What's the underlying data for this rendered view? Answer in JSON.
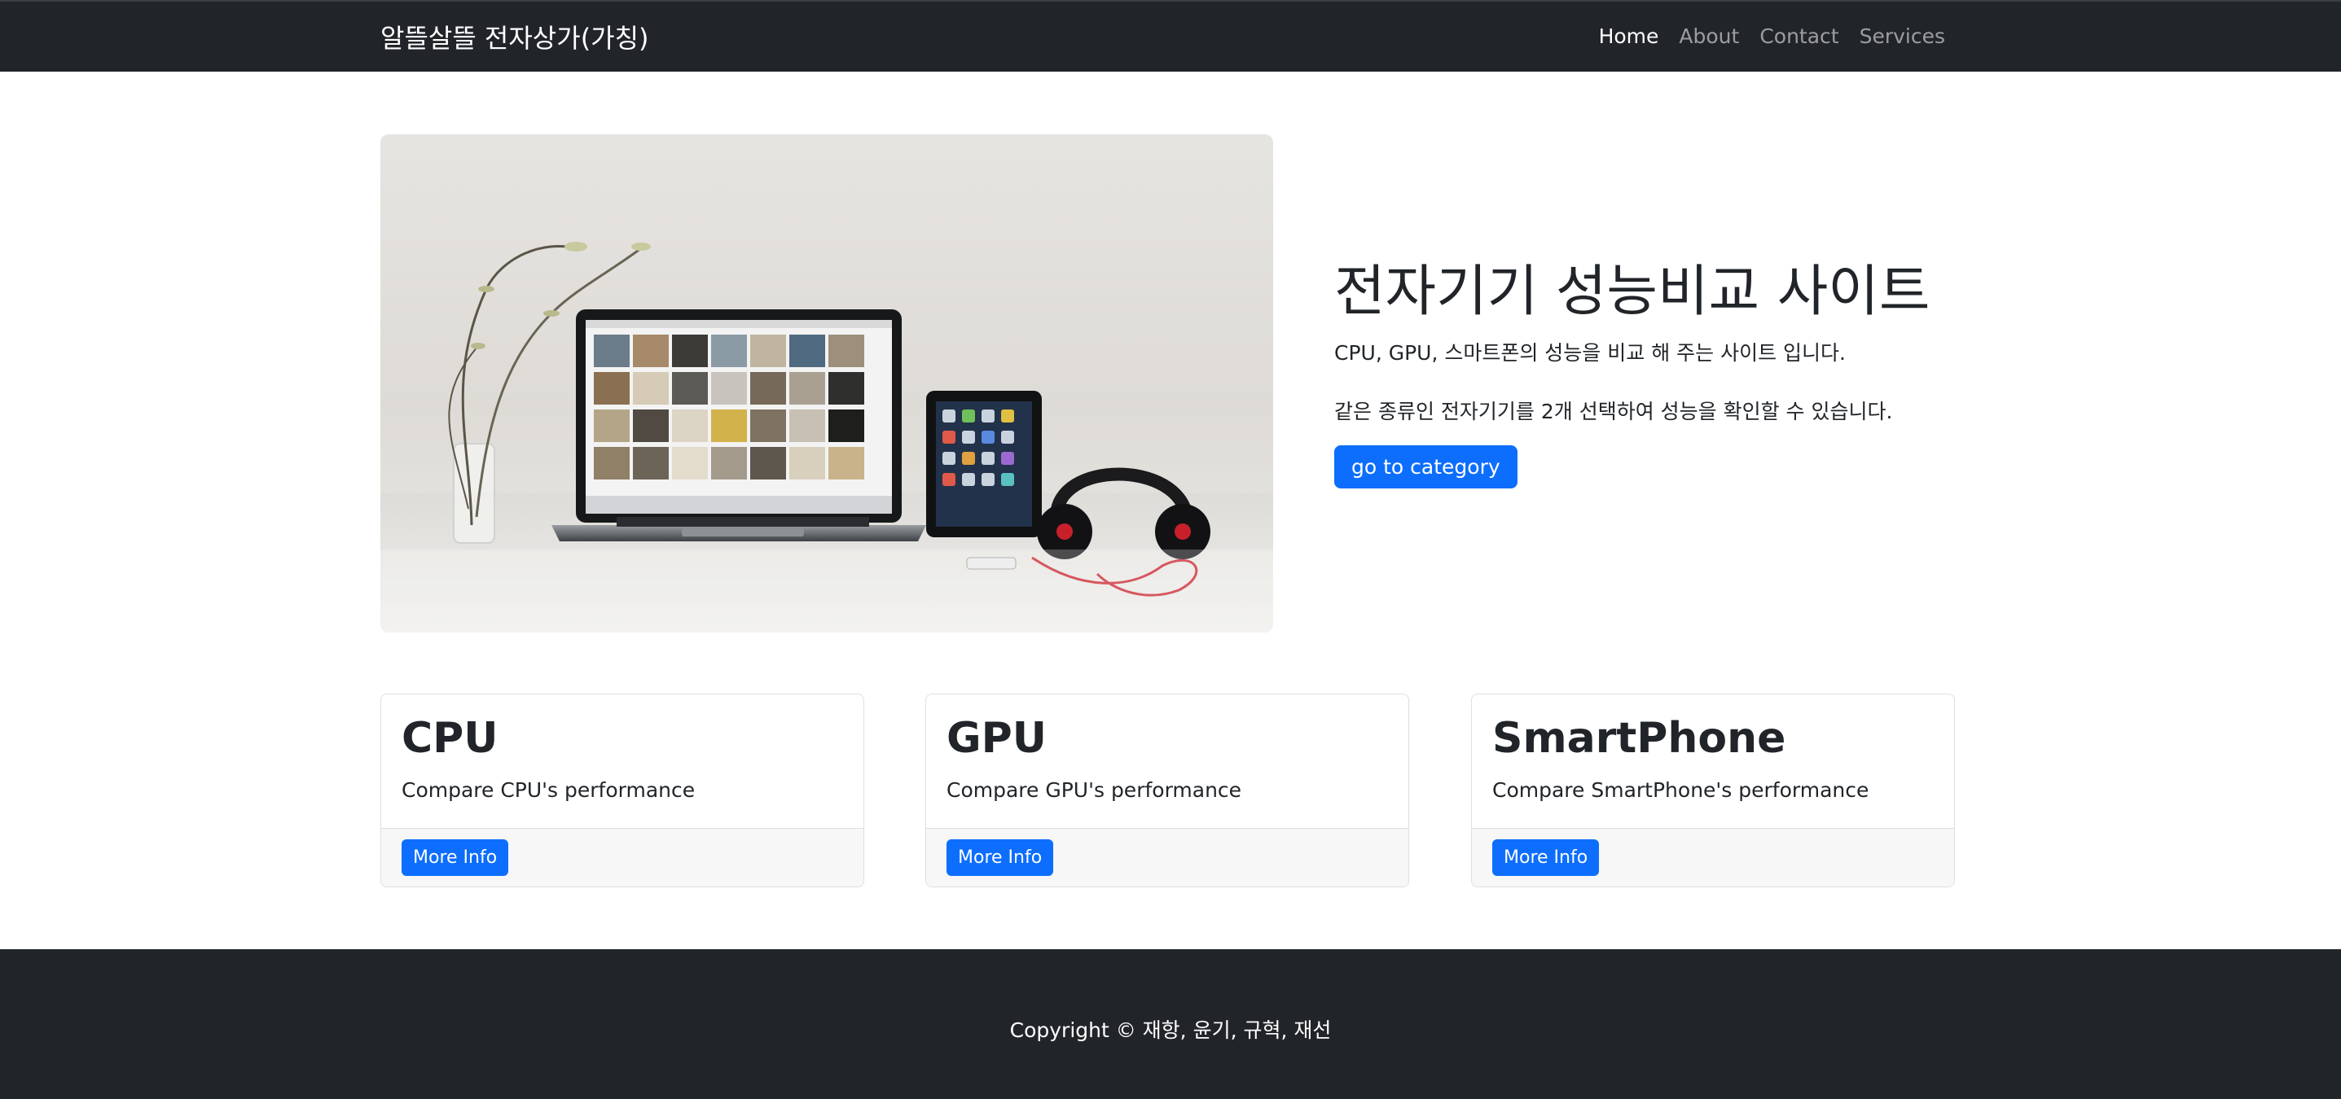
{
  "navbar": {
    "brand": "알뜰살뜰 전자상가(가칭)",
    "items": [
      {
        "label": "Home",
        "active": true
      },
      {
        "label": "About"
      },
      {
        "label": "Contact"
      },
      {
        "label": "Services"
      }
    ]
  },
  "hero": {
    "title": "전자기기 성능비교 사이트",
    "line1": "CPU, GPU, 스마트폰의 성능을 비교 해 주는 사이트 입니다.",
    "line2": "같은 종류인 전자기기를 2개 선택하여 성능을 확인할 수 있습니다.",
    "button": "go to category"
  },
  "cards": [
    {
      "title": "CPU",
      "text": "Compare CPU's performance",
      "button": "More Info"
    },
    {
      "title": "GPU",
      "text": "Compare GPU's performance",
      "button": "More Info"
    },
    {
      "title": "SmartPhone",
      "text": "Compare SmartPhone's performance",
      "button": "More Info"
    }
  ],
  "footer": {
    "copyright": "Copyright © 재항, 윤기, 규혁, 재선"
  },
  "colors": {
    "navbar_bg": "#212529",
    "primary": "#0d6efd",
    "card_footer_bg": "#f7f7f7"
  }
}
